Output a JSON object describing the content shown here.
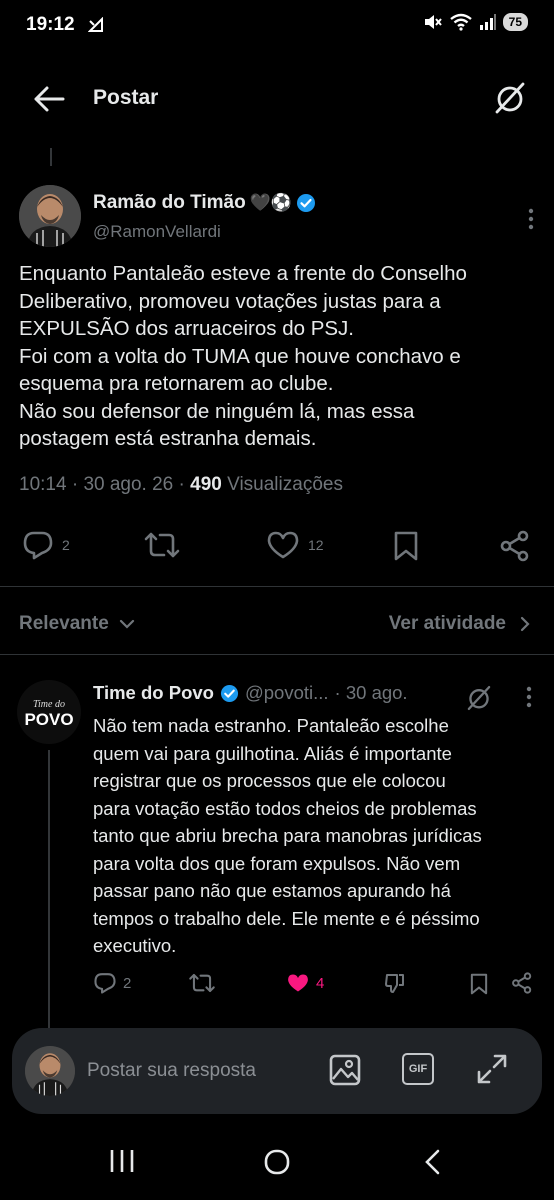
{
  "status_bar": {
    "time": "19:12",
    "battery": "75"
  },
  "header": {
    "title": "Postar"
  },
  "post": {
    "author_name": "Ramão do Timão",
    "author_emoji": "🖤⚽",
    "handle": "@RamonVellardi",
    "text_lines": [
      "Enquanto Pantaleão esteve a frente do Conselho",
      "Deliberativo, promoveu votações justas para a",
      "EXPULSÃO dos arruaceiros do PSJ.",
      "Foi com a volta do TUMA que houve conchavo e",
      "esquema pra retornarem ao clube.",
      "Não sou defensor de ninguém lá, mas essa",
      "postagem está estranha demais."
    ],
    "time": "10:14",
    "date": "30 ago. 26",
    "views_count": "490",
    "views_label": "Visualizações",
    "replies": "2",
    "likes": "12"
  },
  "sort": {
    "left_label": "Relevante",
    "right_label": "Ver atividade"
  },
  "reply": {
    "avatar_text_top": "Time do",
    "avatar_text_bottom": "POVO",
    "name": "Time do Povo",
    "handle": "@povoti...",
    "date": "· 30 ago.",
    "text_lines": [
      "Não tem nada estranho. Pantaleão escolhe",
      "quem vai para guilhotina. Aliás é importante",
      "registrar que os processos que ele colocou",
      "para votação estão todos cheios de problemas",
      "tanto que abriu brecha para manobras jurídicas",
      "para volta dos que foram expulsos. Não vem",
      "passar pano não que estamos apurando há",
      "tempos o trabalho dele. Ele mente e é péssimo",
      "executivo."
    ],
    "replies": "2",
    "likes": "4"
  },
  "compose": {
    "placeholder": "Postar sua resposta",
    "gif_label": "GIF"
  },
  "colors": {
    "background": "#000000",
    "text": "#e7e9ea",
    "muted": "#71767b",
    "verified": "#1d9bf0",
    "like_active": "#f91880",
    "compose_bg": "#202327"
  },
  "icons": [
    "back-arrow-icon",
    "grok-icon",
    "verified-badge-icon",
    "more-icon",
    "reply-icon",
    "repost-icon",
    "like-icon",
    "bookmark-icon",
    "share-icon",
    "chevron-down-icon",
    "chevron-right-icon",
    "downvote-icon",
    "image-icon",
    "gif-icon",
    "expand-icon"
  ]
}
